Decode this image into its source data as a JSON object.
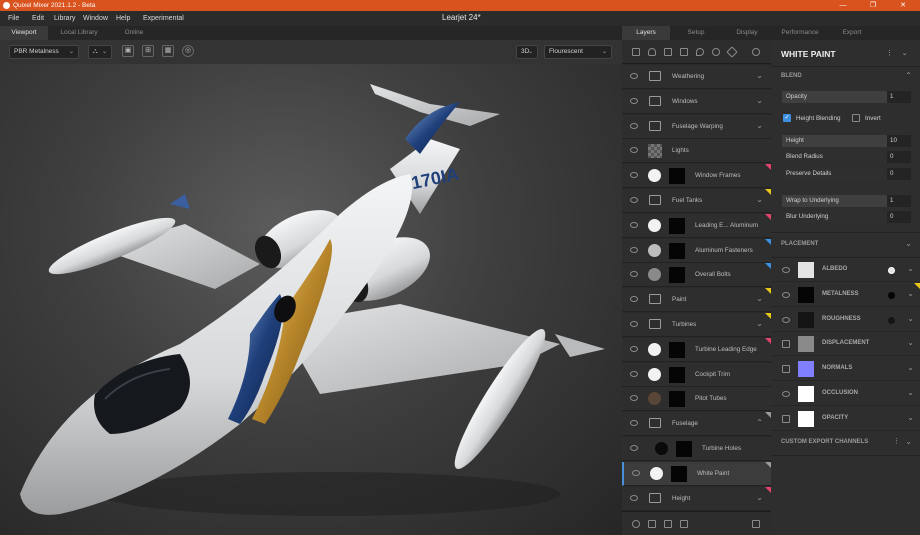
{
  "window": {
    "app_title": "Quixel Mixer 2021.1.2 - Beta",
    "controls": [
      "—",
      "❐",
      "✕"
    ]
  },
  "menu": {
    "items": [
      "File",
      "Edit",
      "Library",
      "Window",
      "Help",
      "Experimental"
    ],
    "document_title": "Learjet 24*"
  },
  "viewport_tabs": [
    {
      "label": "Viewport",
      "active": true
    },
    {
      "label": "Local Library",
      "active": false
    },
    {
      "label": "Online",
      "active": false
    }
  ],
  "viewport_toolbar": {
    "material_mode": "PBR Metalness",
    "view_mode": "3D",
    "lighting": "Flourescent"
  },
  "aircraft": {
    "tail_number": "N170IA",
    "colors": {
      "body": "#e6e8ea",
      "blue": "#1f3f7a",
      "gold": "#c9a33a",
      "glass": "#1a1f24"
    }
  },
  "panel_tabs": [
    {
      "label": "Layers",
      "active": true
    },
    {
      "label": "Setup",
      "active": false
    },
    {
      "label": "Display",
      "active": false
    },
    {
      "label": "Performance",
      "active": false
    },
    {
      "label": "Export",
      "active": false
    }
  ],
  "layers": [
    {
      "name": "Weathering",
      "kind": "folder",
      "expand": "down",
      "tag": ""
    },
    {
      "name": "Windows",
      "kind": "folder",
      "expand": "down",
      "tag": ""
    },
    {
      "name": "Fuselage Warping",
      "kind": "folder",
      "expand": "down",
      "tag": ""
    },
    {
      "name": "Lights",
      "kind": "checker",
      "expand": "",
      "tag": ""
    },
    {
      "name": "Window Frames",
      "kind": "fill",
      "swatch": "#f2f2f2",
      "expand": "",
      "tag": "#e0436b"
    },
    {
      "name": "Fuel Tanks",
      "kind": "folder",
      "expand": "down",
      "tag": "#e6c619"
    },
    {
      "name": "Leading E... Aluminum",
      "kind": "fill",
      "swatch": "#f2f2f2",
      "expand": "",
      "tag": "#e0436b"
    },
    {
      "name": "Aluminum Fasteners",
      "kind": "fill",
      "swatch": "#bdbdbd",
      "expand": "",
      "tag": "#3d8fe0"
    },
    {
      "name": "Overall Bolts",
      "kind": "fill",
      "swatch": "#8a8a8a",
      "expand": "",
      "tag": "#3d8fe0"
    },
    {
      "name": "Paint",
      "kind": "folder",
      "expand": "down",
      "tag": "#e6c619"
    },
    {
      "name": "Turbines",
      "kind": "folder",
      "expand": "down",
      "tag": "#e6c619"
    },
    {
      "name": "Turbine Leading Edge",
      "kind": "fill",
      "swatch": "#f2f2f2",
      "expand": "",
      "tag": "#e0436b"
    },
    {
      "name": "Cockpit Trim",
      "kind": "fill",
      "swatch": "#f2f2f2",
      "expand": "",
      "tag": ""
    },
    {
      "name": "Pitot Tubes",
      "kind": "fill",
      "swatch": "#5a4636",
      "expand": "",
      "tag": ""
    },
    {
      "name": "Fuselage",
      "kind": "folder",
      "expand": "up",
      "tag": "#9a9a9a"
    },
    {
      "name": "Turbine Holes",
      "kind": "fill-dark",
      "swatch": "#0a0a0a",
      "expand": "",
      "tag": ""
    },
    {
      "name": "White Paint",
      "kind": "fill",
      "swatch": "#f2f2f2",
      "expand": "",
      "tag": "#9a9a9a",
      "selected": true
    },
    {
      "name": "Height",
      "kind": "folder",
      "expand": "down",
      "tag": "#e0436b"
    }
  ],
  "properties": {
    "title": "WHITE PAINT",
    "blend": {
      "section_label": "BLEND",
      "opacity_label": "Opacity",
      "opacity_value": "1",
      "height_blending_label": "Height Blending",
      "height_blending": true,
      "invert_label": "Invert",
      "invert": false,
      "height_label": "Height",
      "height_value": "10",
      "blend_radius_label": "Blend Radius",
      "blend_radius_value": "0",
      "preserve_details_label": "Preserve Details",
      "preserve_details_value": "0",
      "wrap_label": "Wrap to Underlying",
      "wrap_value": "1",
      "blur_label": "Blur Underlying",
      "blur_value": "0"
    },
    "placement_label": "PLACEMENT",
    "channels": [
      {
        "name": "ALBEDO",
        "enabled": true,
        "swatch": "#e4e4e4",
        "dot": "#e4e4e4",
        "tag": ""
      },
      {
        "name": "METALNESS",
        "enabled": true,
        "swatch": "#050505",
        "dot": "#050505",
        "tag": "#e6c619"
      },
      {
        "name": "ROUGHNESS",
        "enabled": true,
        "swatch": "#151515",
        "dot": "#151515",
        "tag": ""
      },
      {
        "name": "DISPLACEMENT",
        "enabled": false,
        "swatch": "#8a8a8a",
        "dot": "",
        "tag": ""
      },
      {
        "name": "NORMALS",
        "enabled": false,
        "swatch": "#8080ff",
        "dot": "",
        "tag": ""
      },
      {
        "name": "OCCLUSION",
        "enabled": true,
        "swatch": "#ffffff",
        "dot": "",
        "tag": ""
      },
      {
        "name": "OPACITY",
        "enabled": false,
        "swatch": "#ffffff",
        "dot": "",
        "tag": ""
      }
    ],
    "custom_export_label": "CUSTOM EXPORT CHANNELS"
  }
}
